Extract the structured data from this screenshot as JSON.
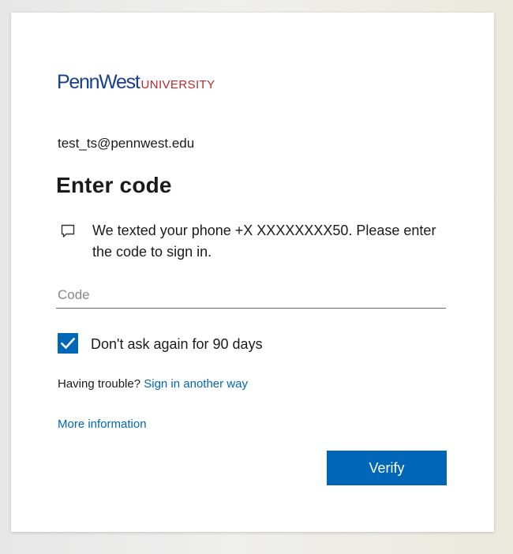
{
  "brand": {
    "name": "PennWest",
    "suffix": "UNIVERSITY",
    "primary_color": "#1b3f8f",
    "accent_color": "#b32a2f"
  },
  "account": {
    "email": "test_ts@pennwest.edu"
  },
  "page": {
    "title": "Enter code",
    "message_icon": "message-icon",
    "message": "We texted your phone +X XXXXXXXX50. Please enter the code to sign in."
  },
  "code_field": {
    "placeholder": "Code",
    "value": ""
  },
  "remember": {
    "label": "Don't ask again for 90 days",
    "checked": true,
    "icon": "checkmark-icon"
  },
  "help": {
    "trouble_text": "Having trouble?",
    "sign_in_other_label": "Sign in another way",
    "more_info_label": "More information"
  },
  "actions": {
    "verify_label": "Verify",
    "button_color": "#0067b8"
  }
}
